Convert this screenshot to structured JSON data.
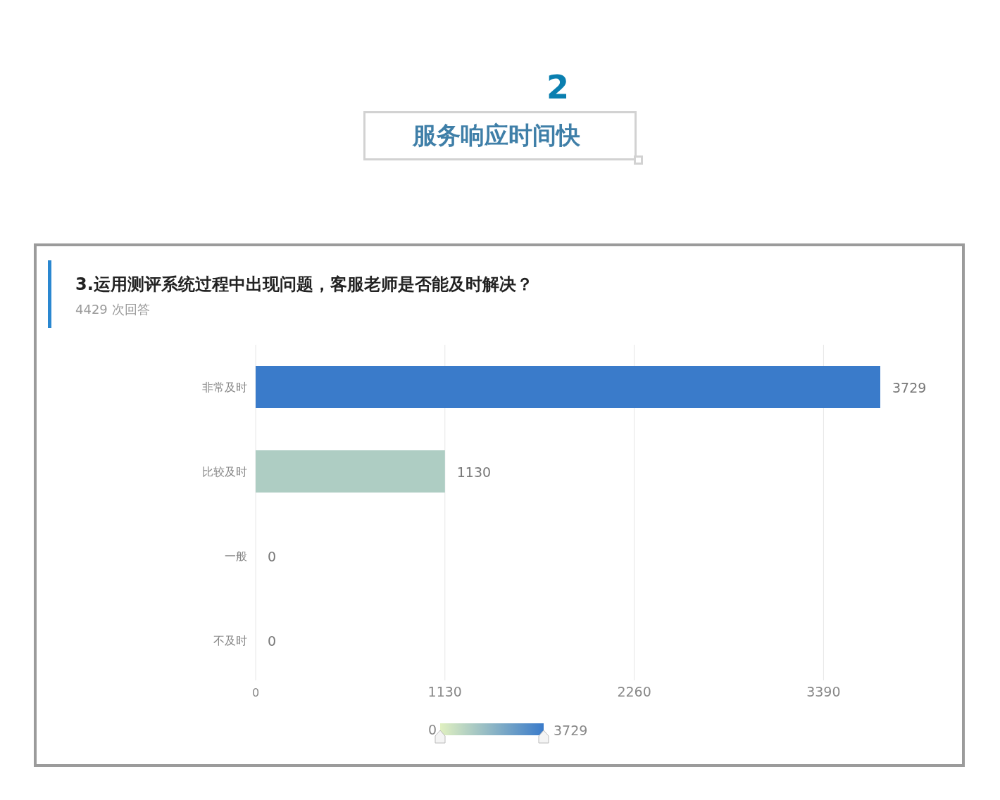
{
  "section": {
    "number": "2",
    "title": "服务响应时间快"
  },
  "question": {
    "title": "3.运用测评系统过程中出现问题，客服老师是否能及时解决？",
    "responses": "4429 次回答",
    "chart_data": {
      "type": "bar",
      "orientation": "horizontal",
      "categories": [
        "非常及时",
        "比较及时",
        "一般",
        "不及时"
      ],
      "series": [
        {
          "values": [
            3729,
            1130,
            0,
            0
          ]
        }
      ],
      "xlim": [
        0,
        3729
      ],
      "grid": true,
      "xticks": [
        0,
        1130,
        2260,
        3390
      ],
      "data_labels": true
    }
  },
  "visual_map": {
    "min_label": "0",
    "max_label": "3729"
  }
}
